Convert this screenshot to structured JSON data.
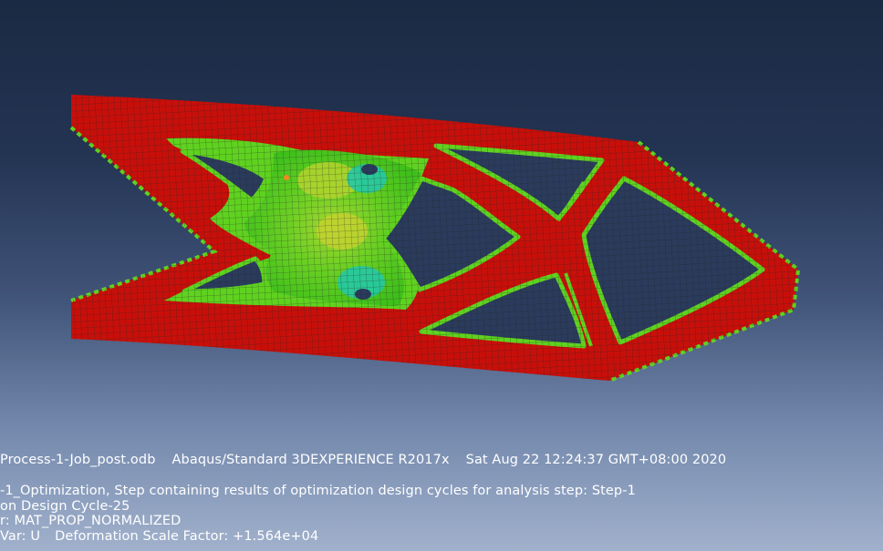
{
  "viewport": {
    "background_top": "#1b2a43",
    "background_bottom": "#a1b1cc"
  },
  "model": {
    "contour_colors": {
      "solid": "#c80f0a",
      "transition": "#5fd21f",
      "mid": "#8cd22a",
      "low": "#19c8b4",
      "mesh": "#222222"
    }
  },
  "odb_info": {
    "odb_name": "Process-1-Job_post.odb",
    "solver": "Abaqus/Standard 3DEXPERIENCE R2017x",
    "timestamp": "Sat Aug 22 12:24:37 GMT+08:00 2020"
  },
  "step_info": {
    "step_line": "-1_Optimization, Step containing results of optimization design cycles for analysis step: Step-1",
    "cycle_line": "on Design Cycle-25",
    "variable_line": "r: MAT_PROP_NORMALIZED",
    "deformed_var": "Var: U",
    "scale_factor": "Deformation Scale Factor: +1.564e+04"
  }
}
